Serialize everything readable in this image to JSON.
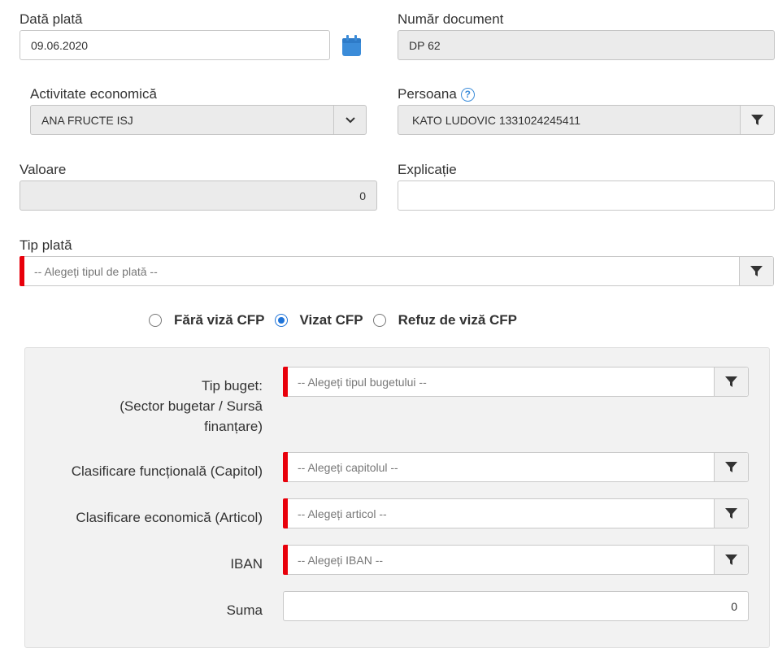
{
  "fields": {
    "data_plata": {
      "label": "Dată plată",
      "value": "09.06.2020"
    },
    "numar_document": {
      "label": "Număr document",
      "value": "DP 62"
    },
    "activitate": {
      "label": "Activitate economică",
      "value": "ANA FRUCTE ISJ"
    },
    "persoana": {
      "label": "Persoana",
      "value": "KATO LUDOVIC 1331024245411",
      "help": "?"
    },
    "valoare": {
      "label": "Valoare",
      "value": "0"
    },
    "explicatie": {
      "label": "Explicație",
      "value": ""
    },
    "tip_plata": {
      "label": "Tip plată",
      "placeholder": "-- Alegeți tipul de plată --"
    }
  },
  "viza": {
    "options": [
      "Fără viză CFP",
      "Vizat CFP",
      "Refuz de viză CFP"
    ],
    "selected": "Vizat CFP"
  },
  "panel": {
    "tip_buget": {
      "label_line1": "Tip buget:",
      "label_line2": "(Sector bugetar / Sursă",
      "label_line3": "finanțare)",
      "placeholder": "-- Alegeți tipul bugetului --"
    },
    "clasificare_functionala": {
      "label": "Clasificare funcțională (Capitol)",
      "placeholder": "-- Alegeți capitolul --"
    },
    "clasificare_economica": {
      "label": "Clasificare economică (Articol)",
      "placeholder": "-- Alegeți articol --"
    },
    "iban": {
      "label": "IBAN",
      "placeholder": "-- Alegeți IBAN --"
    },
    "suma": {
      "label": "Suma",
      "value": "0"
    }
  },
  "icons": {
    "calendar": "calendar-icon",
    "filter": "filter-icon",
    "chevron": "chevron-down-icon",
    "help": "help-icon"
  },
  "colors": {
    "required": "#e8000b",
    "accent": "#1e73d8",
    "calendar": "#3b8cd9"
  }
}
